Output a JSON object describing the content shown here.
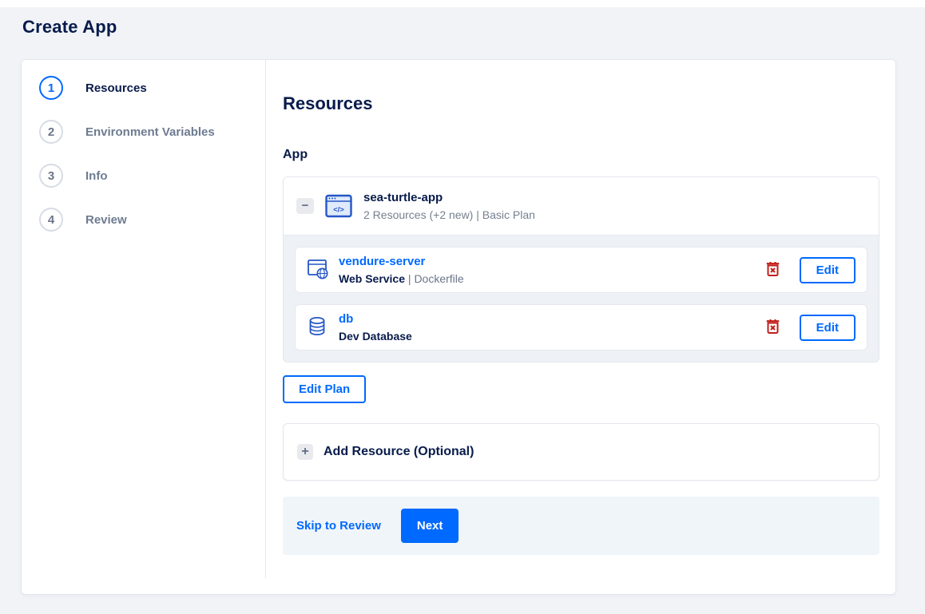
{
  "page": {
    "title": "Create App"
  },
  "colors": {
    "accent": "#0069ff",
    "navy": "#081b4b",
    "danger": "#c11f1a",
    "group_body_bg": "#eef1f5",
    "footer_bg": "#f0f5fa"
  },
  "steps": [
    {
      "number": "1",
      "label": "Resources",
      "active": true
    },
    {
      "number": "2",
      "label": "Environment Variables",
      "active": false
    },
    {
      "number": "3",
      "label": "Info",
      "active": false
    },
    {
      "number": "4",
      "label": "Review",
      "active": false
    }
  ],
  "main": {
    "heading": "Resources",
    "section_label": "App",
    "app_group": {
      "name": "sea-turtle-app",
      "summary": "2 Resources (+2 new) | Basic Plan",
      "collapse_glyph": "−"
    },
    "resources": [
      {
        "name": "vendure-server",
        "type": "Web Service",
        "separator": "|",
        "detail": "Dockerfile",
        "edit_label": "Edit"
      },
      {
        "name": "db",
        "type": "Dev Database",
        "separator": "",
        "detail": "",
        "edit_label": "Edit"
      }
    ],
    "edit_plan_label": "Edit Plan",
    "add_resource": {
      "label": "Add Resource (Optional)",
      "plus_glyph": "+"
    },
    "footer": {
      "skip_label": "Skip to Review",
      "next_label": "Next"
    }
  }
}
